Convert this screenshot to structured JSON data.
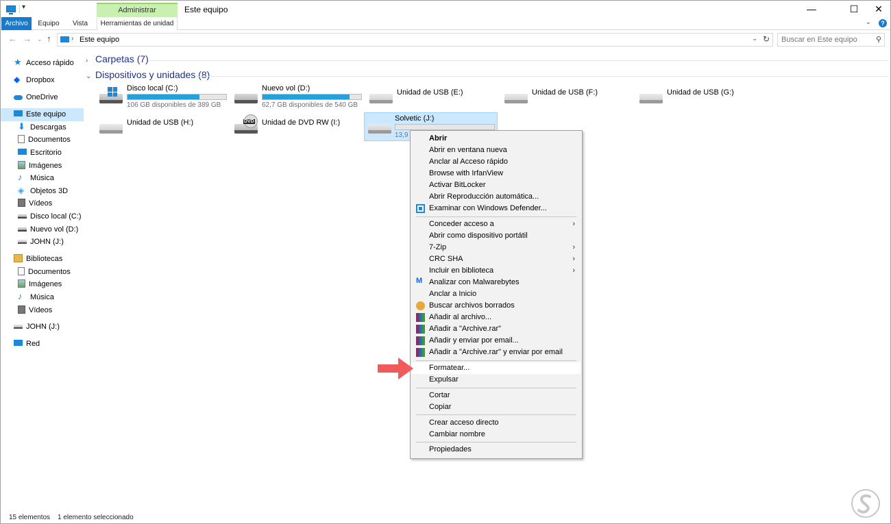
{
  "title_bar": {
    "window_title": "Este equipo",
    "context_tab_header": "Administrar",
    "minimize": "—",
    "maximize": "☐",
    "close": "✕"
  },
  "ribbon": {
    "tabs": [
      "Archivo",
      "Equipo",
      "Vista"
    ],
    "context_tab": "Herramientas de unidad"
  },
  "address_bar": {
    "path": "Este equipo",
    "search_placeholder": "Buscar en Este equipo"
  },
  "sidebar": {
    "items": [
      {
        "label": "Acceso rápido",
        "icon": "star-icon"
      },
      {
        "label": "Dropbox",
        "icon": "dropbox-icon"
      },
      {
        "label": "OneDrive",
        "icon": "cloud-icon"
      },
      {
        "label": "Este equipo",
        "icon": "computer-icon"
      },
      {
        "label": "Descargas",
        "icon": "download-icon"
      },
      {
        "label": "Documentos",
        "icon": "document-icon"
      },
      {
        "label": "Escritorio",
        "icon": "desktop-icon"
      },
      {
        "label": "Imágenes",
        "icon": "image-icon"
      },
      {
        "label": "Música",
        "icon": "music-icon"
      },
      {
        "label": "Objetos 3D",
        "icon": "cube-icon"
      },
      {
        "label": "Vídeos",
        "icon": "video-icon"
      },
      {
        "label": "Disco local (C:)",
        "icon": "drive-icon"
      },
      {
        "label": "Nuevo vol (D:)",
        "icon": "drive-icon"
      },
      {
        "label": "JOHN (J:)",
        "icon": "usb-drive-icon"
      },
      {
        "label": "Bibliotecas",
        "icon": "library-icon"
      },
      {
        "label": "Documentos",
        "icon": "document-icon"
      },
      {
        "label": "Imágenes",
        "icon": "image-icon"
      },
      {
        "label": "Música",
        "icon": "music-icon"
      },
      {
        "label": "Vídeos",
        "icon": "video-icon"
      },
      {
        "label": "JOHN (J:)",
        "icon": "usb-drive-icon"
      },
      {
        "label": "Red",
        "icon": "network-icon"
      }
    ]
  },
  "groups": {
    "folders": "Carpetas (7)",
    "devices": "Dispositivos y unidades (8)"
  },
  "drives": [
    {
      "name": "Disco local (C:)",
      "free": "106 GB disponibles de 389 GB",
      "used_fraction": 0.73
    },
    {
      "name": "Nuevo vol (D:)",
      "free": "62,7 GB disponibles de 540 GB",
      "used_fraction": 0.88
    },
    {
      "name": "Unidad de USB (E:)"
    },
    {
      "name": "Unidad de USB (F:)"
    },
    {
      "name": "Unidad de USB (G:)"
    },
    {
      "name": "Unidad de USB (H:)"
    },
    {
      "name": "Unidad de DVD RW (I:)",
      "badge": "DVD"
    },
    {
      "name": "Solvetic (J:)",
      "free": "13,9 G",
      "used_fraction": 0.0
    }
  ],
  "context_menu": {
    "items": [
      "Abrir",
      "Abrir en ventana nueva",
      "Anclar al Acceso rápido",
      "Browse with IrfanView",
      "Activar BitLocker",
      "Abrir Reproducción automática...",
      "Examinar con Windows Defender...",
      "Conceder acceso a",
      "Abrir como dispositivo portátil",
      "7-Zip",
      "CRC SHA",
      "Incluir en biblioteca",
      "Analizar con Malwarebytes",
      "Anclar a Inicio",
      "Buscar archivos borrados",
      "Añadir al archivo...",
      "Añadir a \"Archive.rar\"",
      "Añadir y enviar por email...",
      "Añadir a \"Archive.rar\" y enviar por email",
      "Formatear...",
      "Expulsar",
      "Cortar",
      "Copiar",
      "Crear acceso directo",
      "Cambiar nombre",
      "Propiedades"
    ]
  },
  "status_bar": {
    "count": "15 elementos",
    "selected": "1 elemento seleccionado"
  },
  "colors": {
    "accent": "#1979ca",
    "selection": "#cce8ff",
    "drive_bar": "#26a0da",
    "context_tab": "#c9f0b0",
    "pointer_arrow": "#f05a5a"
  }
}
